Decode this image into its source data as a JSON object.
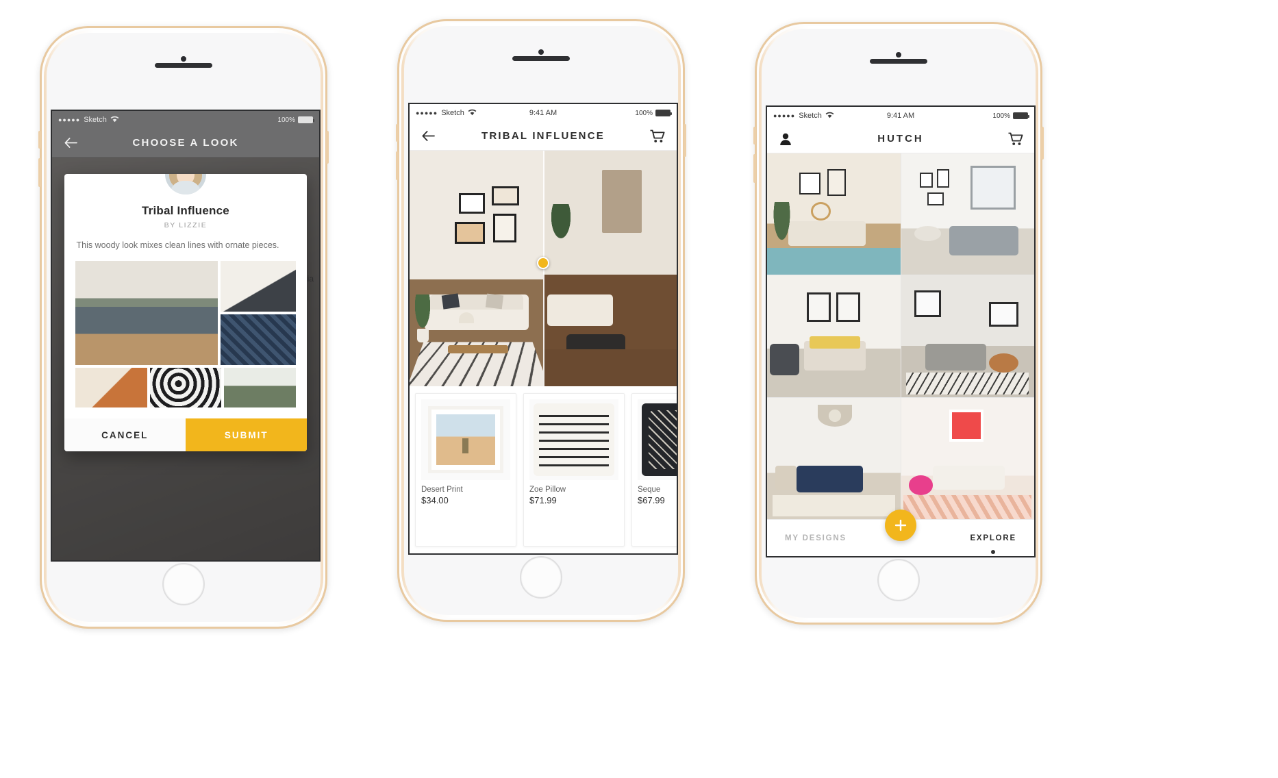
{
  "meta": {
    "status_carrier": "Sketch",
    "status_time": "9:41 AM",
    "status_battery": "100%",
    "status_dots": "●●●●●",
    "accent_yellow": "#F2B61C",
    "dark_text": "#2E2E2E"
  },
  "phone1": {
    "nav": {
      "title": "CHOOSE A LOOK",
      "back_icon": "arrow-left-icon"
    },
    "modal": {
      "avatar_icon": "designer-avatar",
      "title": "Tribal Influence",
      "byline": "BY LIZZIE",
      "description": "This woody look mixes clean lines with ornate pieces.",
      "cancel_label": "CANCEL",
      "submit_label": "SUBMIT"
    },
    "background_text": "stria"
  },
  "phone2": {
    "nav": {
      "title": "TRIBAL INFLUENCE",
      "back_icon": "arrow-left-icon",
      "cart_icon": "shopping-cart-icon"
    },
    "compare": {
      "handle_icon": "compare-slider-handle"
    },
    "products": [
      {
        "name": "Desert Print",
        "price": "$34.00",
        "image": "framed-desert-art-print"
      },
      {
        "name": "Zoe Pillow",
        "price": "$71.99",
        "image": "black-white-chevron-pillow"
      },
      {
        "name": "Seque",
        "price": "$67.99",
        "image": "dark-patterned-pillow"
      }
    ]
  },
  "phone3": {
    "nav": {
      "title": "HUTCH",
      "profile_icon": "person-icon",
      "cart_icon": "shopping-cart-icon"
    },
    "gallery": [
      {
        "label": "living-room-neutral-gallery-wall"
      },
      {
        "label": "living-room-gray-sofa-windows"
      },
      {
        "label": "bedroom-yellow-accent"
      },
      {
        "label": "living-room-leather-ottoman"
      },
      {
        "label": "living-room-navy-sofa-chandelier"
      },
      {
        "label": "living-room-pink-rug-art"
      }
    ],
    "tabs": {
      "my_designs": "MY DESIGNS",
      "explore": "EXPLORE",
      "add_icon": "plus-icon",
      "active": "EXPLORE"
    }
  }
}
